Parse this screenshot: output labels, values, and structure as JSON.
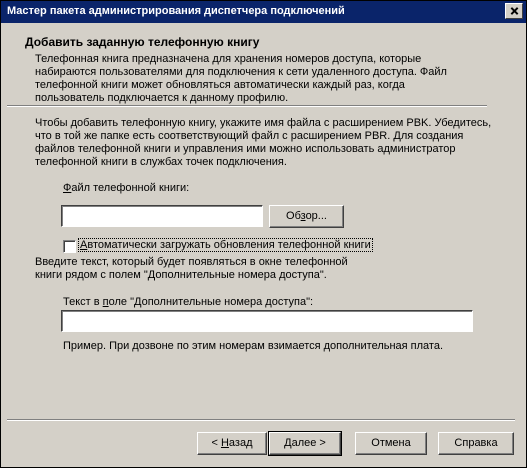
{
  "window": {
    "title": "Мастер пакета администрирования диспетчера подключений"
  },
  "header": {
    "title": "Добавить заданную телефонную книгу",
    "description": "Телефонная книга предназначена для хранения номеров доступа, которые набираются пользователями для подключения к сети удаленного доступа. Файл телефонной книги может обновляться автоматически каждый раз, когда пользователь подключается к данному профилю."
  },
  "main": {
    "instructions": "Чтобы добавить телефонную книгу, укажите имя файла с расширением PBK. Убедитесь, что в той же папке есть соответствующий файл с расширением PBR. Для создания файлов телефонной книги и управления ими можно использовать администратор телефонной книги в службах точек подключения.",
    "file_label_prefix": "",
    "file_label_hotkey": "Ф",
    "file_label_rest": "айл телефонной книги:",
    "file_value": "",
    "browse_label_pre": "Об",
    "browse_label_hotkey": "з",
    "browse_label_post": "ор...",
    "auto_update_hotkey": "А",
    "auto_update_rest": "втоматически загружать обновления телефонной книги",
    "auto_update_checked": false,
    "more_text": "Введите текст, который будет появляться в окне телефонной книги рядом с полем \"Дополнительные номера доступа\".",
    "more_label_pre": "Текст в ",
    "more_label_hotkey": "п",
    "more_label_post": "оле \"Дополнительные номера доступа\":",
    "more_value": "",
    "example": "Пример. При дозвоне по этим номерам взимается дополнительная плата."
  },
  "footer": {
    "back_prefix": "< ",
    "back_hotkey": "Н",
    "back_rest": "азад",
    "next_hotkey": "Д",
    "next_rest": "алее >",
    "cancel_label": "Отмена",
    "help_label": "Справка"
  }
}
